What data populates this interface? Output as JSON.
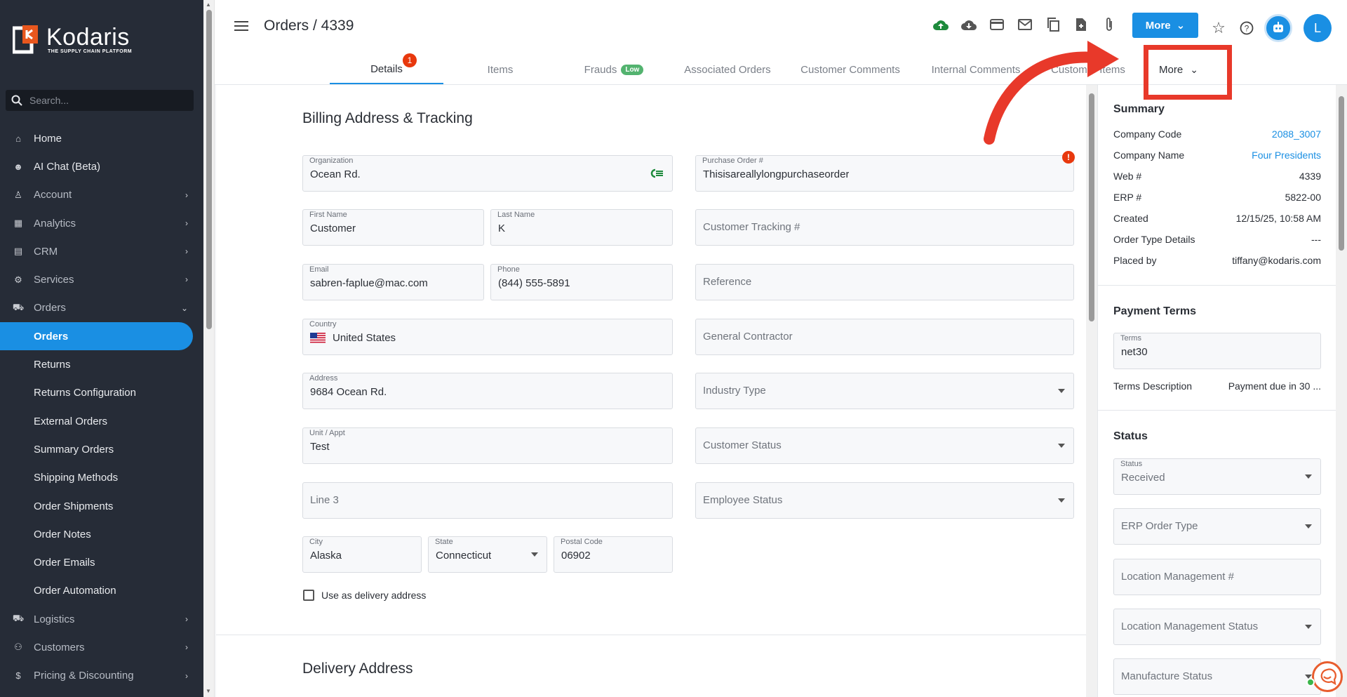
{
  "sidebar": {
    "logo": {
      "name": "Kodaris",
      "tagline": "THE SUPPLY CHAIN PLATFORM"
    },
    "search_placeholder": "Search...",
    "items": [
      {
        "label": "Home",
        "icon": "home-icon"
      },
      {
        "label": "AI Chat (Beta)",
        "icon": "robot-icon"
      },
      {
        "label": "Account",
        "icon": "person-icon"
      },
      {
        "label": "Analytics",
        "icon": "analytics-icon"
      },
      {
        "label": "CRM",
        "icon": "crm-icon"
      },
      {
        "label": "Services",
        "icon": "services-icon"
      },
      {
        "label": "Orders",
        "icon": "truck-icon"
      },
      {
        "label": "Orders"
      },
      {
        "label": "Returns"
      },
      {
        "label": "Returns Configuration"
      },
      {
        "label": "External Orders"
      },
      {
        "label": "Summary Orders"
      },
      {
        "label": "Shipping Methods"
      },
      {
        "label": "Order Shipments"
      },
      {
        "label": "Order Notes"
      },
      {
        "label": "Order Emails"
      },
      {
        "label": "Order Automation"
      },
      {
        "label": "Logistics",
        "icon": "logistics-icon"
      },
      {
        "label": "Customers",
        "icon": "people-icon"
      },
      {
        "label": "Pricing & Discounting",
        "icon": "dollar-icon"
      }
    ]
  },
  "header": {
    "title": "Orders / 4339",
    "more_label": "More",
    "avatar_initial": "L"
  },
  "tabs": [
    {
      "label": "Details",
      "badge": "1"
    },
    {
      "label": "Items"
    },
    {
      "label": "Frauds",
      "badge": "Low"
    },
    {
      "label": "Associated Orders"
    },
    {
      "label": "Customer Comments"
    },
    {
      "label": "Internal Comments"
    },
    {
      "label": "Customer Items"
    },
    {
      "label": "More"
    }
  ],
  "billing": {
    "title": "Billing Address & Tracking",
    "organization": {
      "label": "Organization",
      "value": "Ocean Rd."
    },
    "first_name": {
      "label": "First Name",
      "value": "Customer"
    },
    "last_name": {
      "label": "Last Name",
      "value": "K"
    },
    "email": {
      "label": "Email",
      "value": "sabren-faplue@mac.com"
    },
    "phone": {
      "label": "Phone",
      "value": "(844) 555-5891"
    },
    "country": {
      "label": "Country",
      "value": "United States"
    },
    "address": {
      "label": "Address",
      "value": "9684 Ocean Rd."
    },
    "unit": {
      "label": "Unit / Appt",
      "value": "Test"
    },
    "line3": {
      "placeholder": "Line 3"
    },
    "city": {
      "label": "City",
      "value": "Alaska"
    },
    "state": {
      "label": "State",
      "value": "Connecticut"
    },
    "postal": {
      "label": "Postal Code",
      "value": "06902"
    },
    "use_as_delivery": "Use as delivery address",
    "purchase_order": {
      "label": "Purchase Order #",
      "value": "Thisisareallylongpurchaseorder"
    },
    "customer_tracking": {
      "placeholder": "Customer Tracking #"
    },
    "reference": {
      "placeholder": "Reference"
    },
    "general_contractor": {
      "placeholder": "General Contractor"
    },
    "industry_type": {
      "placeholder": "Industry Type"
    },
    "customer_status": {
      "placeholder": "Customer Status"
    },
    "employee_status": {
      "placeholder": "Employee Status"
    }
  },
  "delivery": {
    "title": "Delivery Address"
  },
  "summary": {
    "title": "Summary",
    "rows": [
      {
        "key": "Company Code",
        "value": "2088_3007",
        "link": true
      },
      {
        "key": "Company Name",
        "value": "Four Presidents",
        "link": true
      },
      {
        "key": "Web #",
        "value": "4339"
      },
      {
        "key": "ERP #",
        "value": "5822-00"
      },
      {
        "key": "Created",
        "value": "12/15/25, 10:58 AM"
      },
      {
        "key": "Order Type Details",
        "value": "---"
      },
      {
        "key": "Placed by",
        "value": "tiffany@kodaris.com"
      }
    ]
  },
  "payment_terms": {
    "title": "Payment Terms",
    "terms_label": "Terms",
    "terms_value": "net30",
    "description_key": "Terms Description",
    "description_value": "Payment due in 30 ..."
  },
  "status": {
    "title": "Status",
    "status_label": "Status",
    "status_value": "Received",
    "erp_order_type": "ERP Order Type",
    "location_management": "Location Management #",
    "location_management_status": "Location Management Status",
    "manufacture_status": "Manufacture Status"
  },
  "colors": {
    "accent": "#1a8fe3",
    "sidebar_bg": "#262c37",
    "annotation_red": "#e8392a",
    "badge_low": "#53b36f"
  }
}
